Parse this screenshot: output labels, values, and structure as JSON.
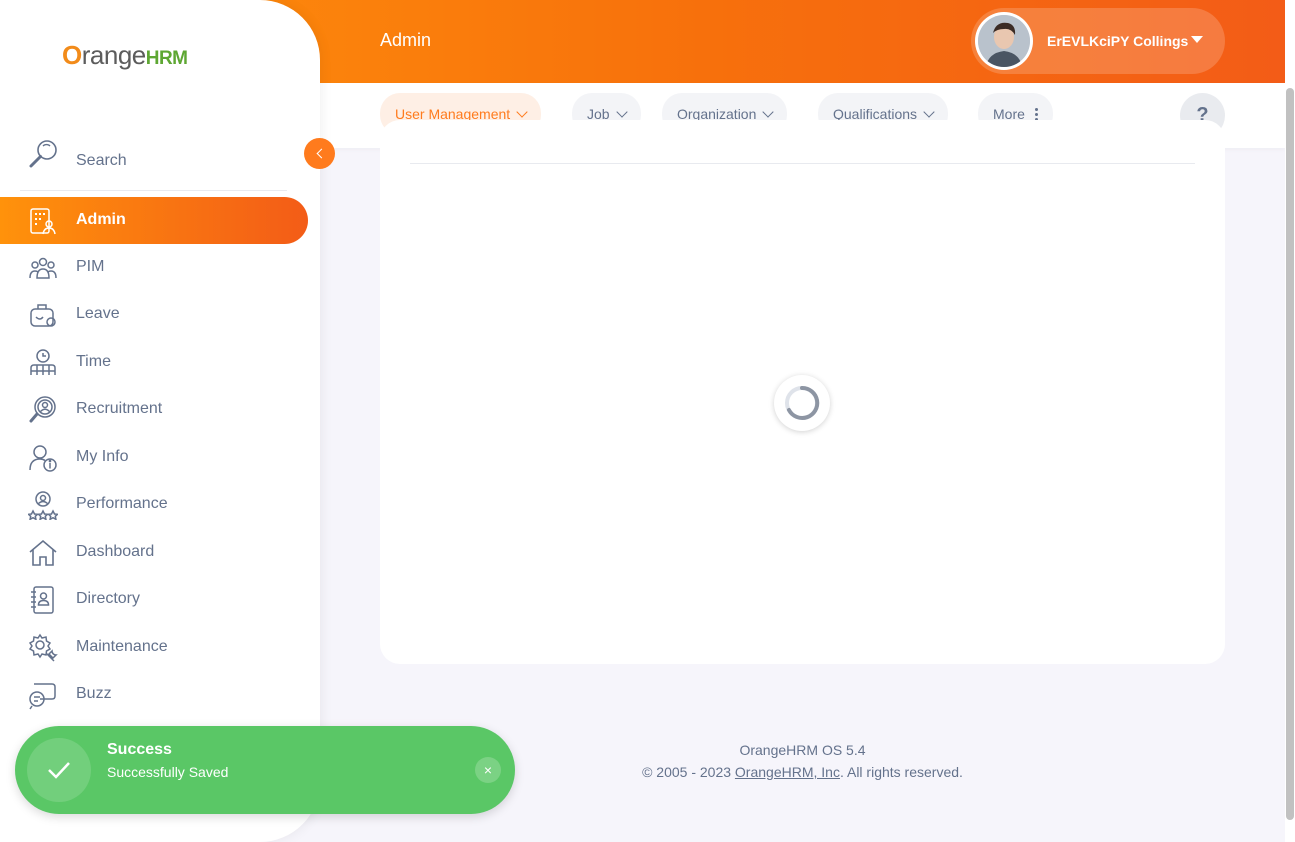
{
  "header": {
    "title": "Admin",
    "user_name": "ErEVLKciPY Collings"
  },
  "topnav": {
    "tabs": [
      {
        "label": "User Management"
      },
      {
        "label": "Job"
      },
      {
        "label": "Organization"
      },
      {
        "label": "Qualifications"
      },
      {
        "label": "More"
      }
    ],
    "help_label": "?"
  },
  "brand": {
    "o": "O",
    "range": "range",
    "hrm": "HRM"
  },
  "sidebar": {
    "search_label": "Search",
    "items": [
      {
        "label": "Admin",
        "icon": "admin-icon"
      },
      {
        "label": "PIM",
        "icon": "pim-icon"
      },
      {
        "label": "Leave",
        "icon": "leave-icon"
      },
      {
        "label": "Time",
        "icon": "time-icon"
      },
      {
        "label": "Recruitment",
        "icon": "recruitment-icon"
      },
      {
        "label": "My Info",
        "icon": "my-info-icon"
      },
      {
        "label": "Performance",
        "icon": "performance-icon"
      },
      {
        "label": "Dashboard",
        "icon": "dashboard-icon"
      },
      {
        "label": "Directory",
        "icon": "directory-icon"
      },
      {
        "label": "Maintenance",
        "icon": "maintenance-icon"
      },
      {
        "label": "Buzz",
        "icon": "buzz-icon"
      }
    ]
  },
  "footer": {
    "version": "OrangeHRM OS 5.4",
    "copyright_prefix": "© 2005 - 2023 ",
    "company_link": "OrangeHRM, Inc",
    "copyright_suffix": ". All rights reserved."
  },
  "toast": {
    "title": "Success",
    "message": "Successfully Saved",
    "close_label": "×"
  },
  "colors": {
    "accent": "#ff7b1d",
    "success": "#5ac766"
  }
}
